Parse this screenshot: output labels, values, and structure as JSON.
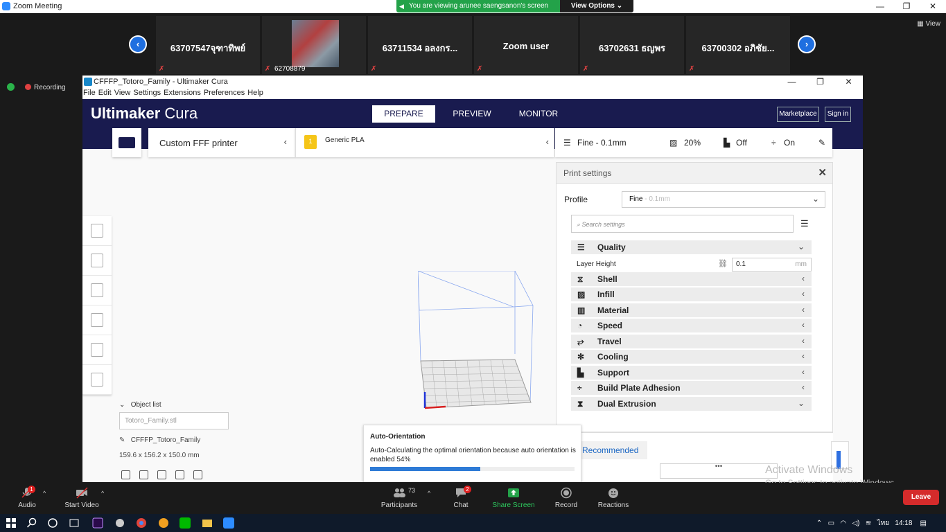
{
  "zoom": {
    "window_title": "Zoom Meeting",
    "viewing_banner": "You are viewing arunee saengsanon's screen",
    "view_options": "View Options ⌄",
    "view_label": "View",
    "recording": "Recording",
    "participants": [
      {
        "name": "63707547จุฑาทิพย์"
      },
      {
        "name": "",
        "id": "62708879"
      },
      {
        "name": "63711534 อลงกร..."
      },
      {
        "name": "Zoom user"
      },
      {
        "name": "63702631 ธญพร"
      },
      {
        "name": "63700302 อภิชัย..."
      }
    ],
    "toolbar": {
      "audio": "Audio",
      "audio_badge": "1",
      "start_video": "Start Video",
      "participants": "Participants",
      "participants_count": "73",
      "chat": "Chat",
      "chat_badge": "2",
      "share_screen": "Share Screen",
      "record": "Record",
      "reactions": "Reactions",
      "leave": "Leave"
    }
  },
  "cura": {
    "window_title": "CFFFP_Totoro_Family - Ultimaker Cura",
    "menu": [
      "File",
      "Edit",
      "View",
      "Settings",
      "Extensions",
      "Preferences",
      "Help"
    ],
    "brand_bold": "Ultimaker",
    "brand_light": " Cura",
    "stages": [
      "PREPARE",
      "PREVIEW",
      "MONITOR"
    ],
    "marketplace": "Marketplace",
    "sign_in": "Sign in",
    "printer": "Custom FFF printer",
    "material_badge": "1",
    "material": "Generic PLA",
    "settings_summary": {
      "profile": "Fine - 0.1mm",
      "infill": "20%",
      "support": "Off",
      "adhesion": "On"
    },
    "object_list": {
      "header": "Object list",
      "file": "Totoro_Family.stl",
      "name": "CFFFP_Totoro_Family",
      "dims": "159.6 x 156.2 x 150.0 mm"
    },
    "print_settings": {
      "title": "Print settings",
      "profile_label": "Profile",
      "profile_value": "Fine",
      "profile_dim": " - 0.1mm",
      "search_placeholder": "Search settings",
      "layer_height_label": "Layer Height",
      "layer_height_value": "0.1",
      "layer_height_unit": "mm",
      "categories": [
        {
          "label": "Quality",
          "expanded": true
        },
        {
          "label": "Shell",
          "expanded": false
        },
        {
          "label": "Infill",
          "expanded": false
        },
        {
          "label": "Material",
          "expanded": false
        },
        {
          "label": "Speed",
          "expanded": false
        },
        {
          "label": "Travel",
          "expanded": false
        },
        {
          "label": "Cooling",
          "expanded": false
        },
        {
          "label": "Support",
          "expanded": false
        },
        {
          "label": "Build Plate Adhesion",
          "expanded": false
        },
        {
          "label": "Dual Extrusion",
          "expanded": true
        }
      ],
      "recommended": "Recommended"
    },
    "auto_orientation": {
      "title": "Auto-Orientation",
      "desc": "Auto-Calculating the optimal orientation because auto orientation is enabled 54%",
      "progress": 0.54
    }
  },
  "windows": {
    "activate_title": "Activate Windows",
    "activate_sub": "Go to Settings to activate Windows.",
    "lang": "ไทย",
    "time": "14:18"
  }
}
